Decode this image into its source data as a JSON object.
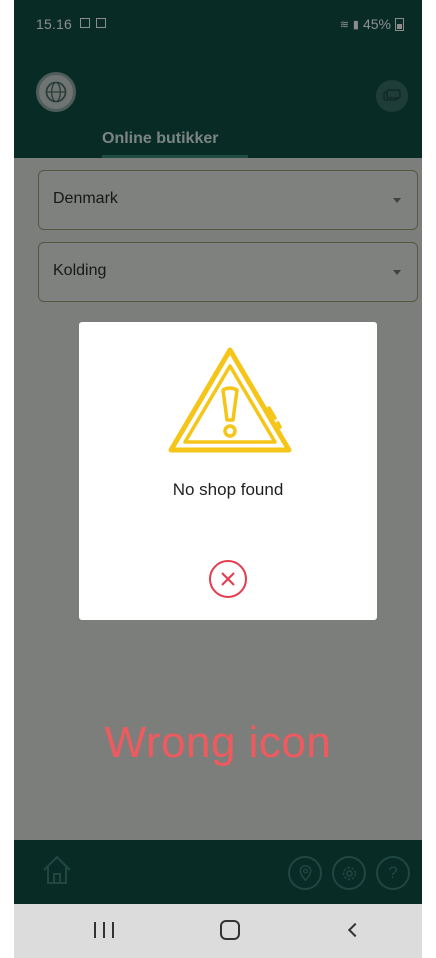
{
  "status_bar": {
    "time": "15.16",
    "battery": "45%"
  },
  "header": {
    "tab_title": "Online butikker"
  },
  "filters": {
    "country": "Denmark",
    "city": "Kolding"
  },
  "dialog": {
    "message": "No shop found"
  },
  "annotation": {
    "text": "Wrong icon"
  },
  "icons": {
    "back": "back-arrow-icon",
    "money": "money-icon",
    "globe": "globe-icon",
    "warning": "warning-icon",
    "close": "close-icon",
    "home": "home-icon",
    "location": "location-pin-icon",
    "settings": "gear-icon",
    "help": "question-icon"
  },
  "colors": {
    "primary_dark": "#0f4f46",
    "warning": "#f5c518",
    "error": "#e53b4c",
    "annotation": "#ef5a5f"
  }
}
